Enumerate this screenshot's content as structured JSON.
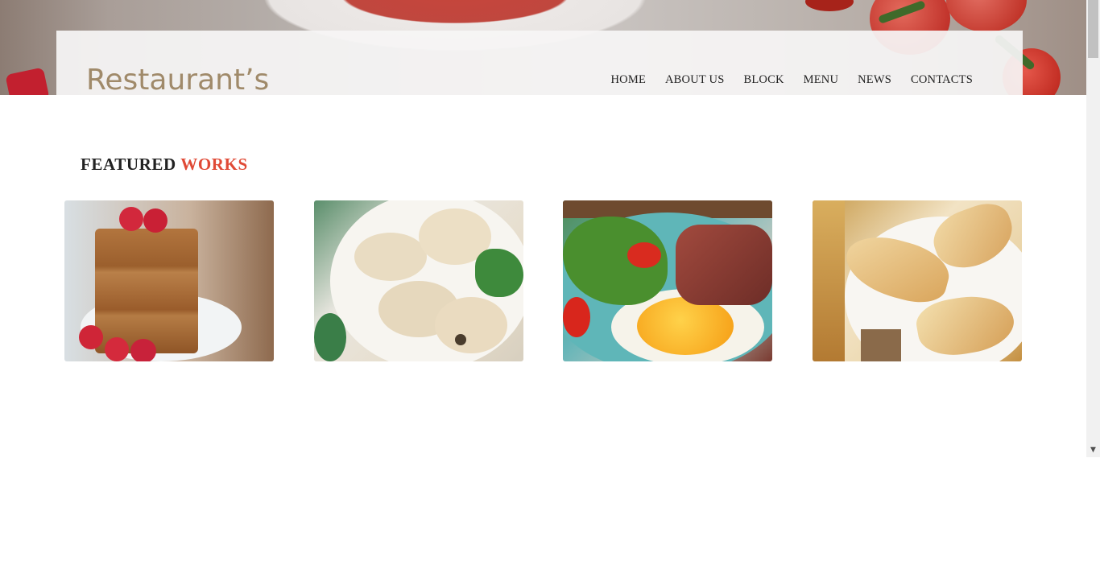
{
  "header": {
    "logo_text": "Restaurant’s",
    "nav": [
      {
        "label": "HOME"
      },
      {
        "label": "ABOUT US"
      },
      {
        "label": "BLOCK"
      },
      {
        "label": "MENU"
      },
      {
        "label": "NEWS"
      },
      {
        "label": "CONTACTS"
      }
    ]
  },
  "featured": {
    "title_plain": "FEATURED",
    "title_accent": "WORKS",
    "accent_color": "#e04a36",
    "items": [
      {
        "image": "raspberry-oat-bars"
      },
      {
        "image": "dumplings-bowl"
      },
      {
        "image": "steak-fried-egg-salad"
      },
      {
        "image": "crepes-plate"
      }
    ]
  },
  "colors": {
    "logo": "#a08a6a",
    "nav_text": "#222222",
    "title_text": "#222222"
  },
  "scrollbar": {
    "down_arrow": "▼"
  }
}
